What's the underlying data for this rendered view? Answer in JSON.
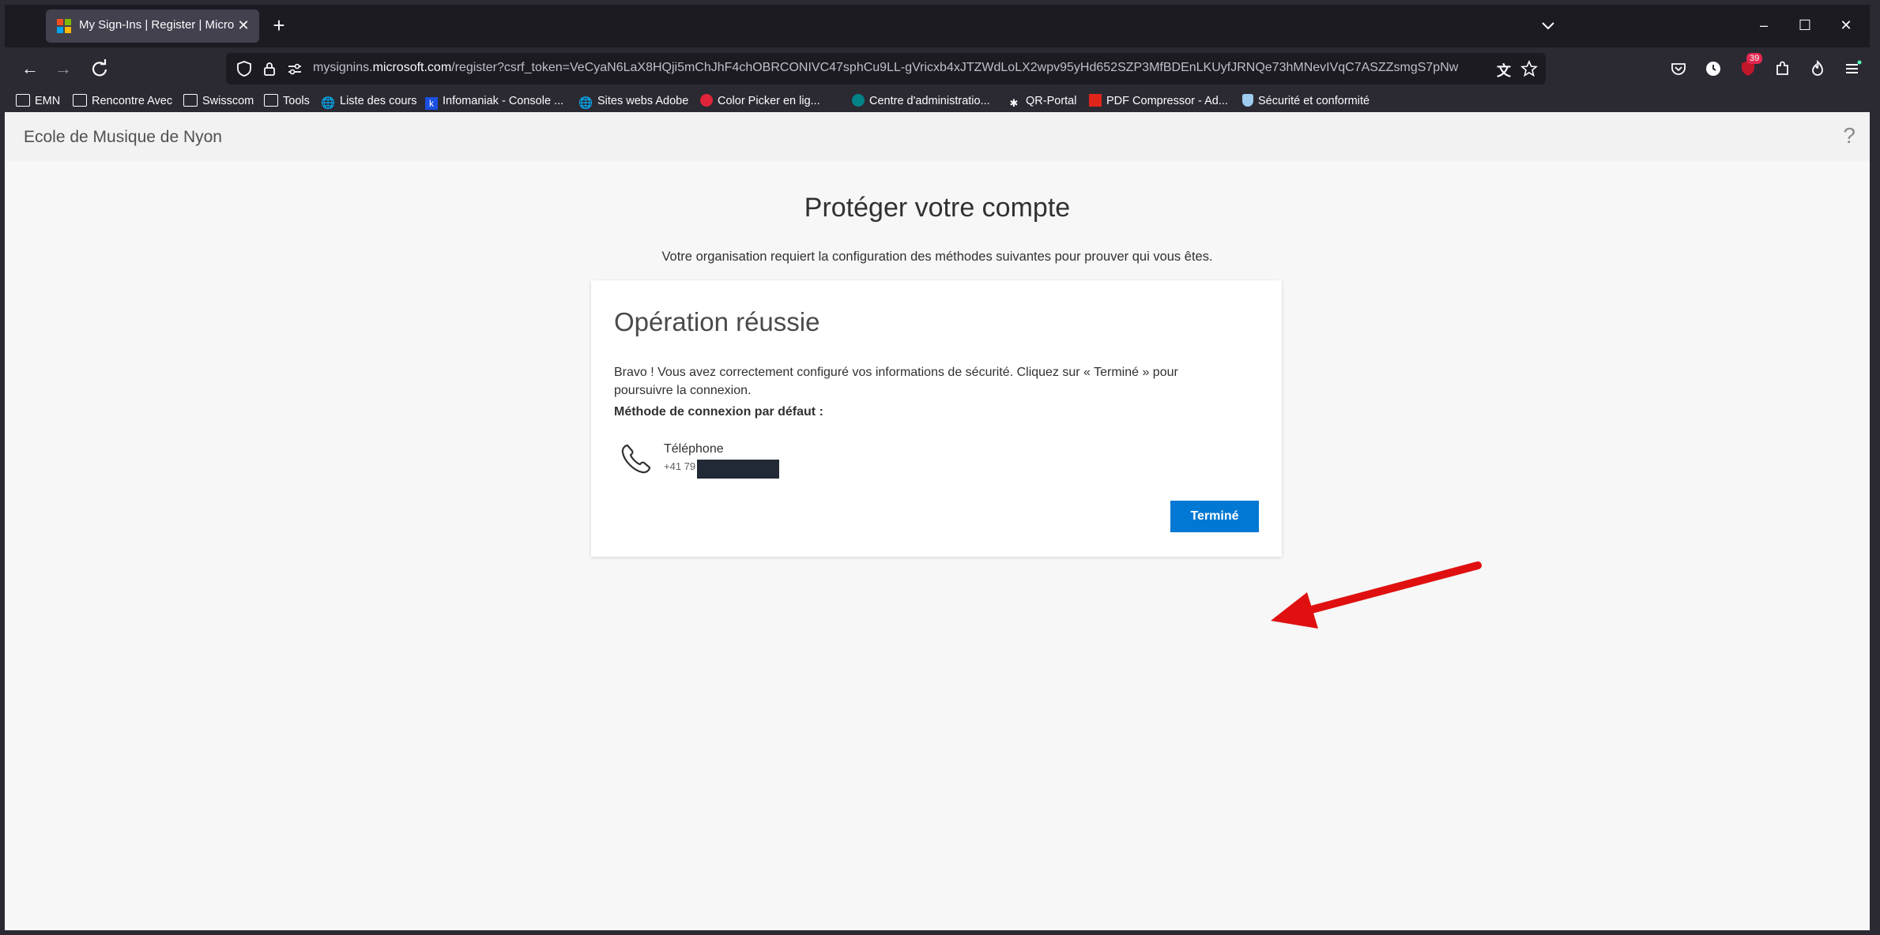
{
  "browser": {
    "tab_title": "My Sign-Ins | Register | Microsoft",
    "url_domain": "mysignins.microsoft.com",
    "url_prefix": "mysignins.",
    "url_domain_core": "microsoft.com",
    "url_path": "/register?csrf_token=VeCyaN6LaX8HQji5mChJhF4chOBRCONIVC47sphCu9LL-gVricxb4xJTZWdLoLX2wpv95yHd652SZP3MfBDEnLKUyfJRNQe73hMNevIVqC7ASZZsmgS7pNw",
    "badge_count": "39"
  },
  "bookmarks": [
    {
      "label": "EMN",
      "icon": "folder-icon"
    },
    {
      "label": "Rencontre Avec",
      "icon": "folder-icon"
    },
    {
      "label": "Swisscom",
      "icon": "folder-icon"
    },
    {
      "label": "Tools",
      "icon": "folder-icon"
    },
    {
      "label": "Liste des cours",
      "icon": "globe-icon"
    },
    {
      "label": "Infomaniak - Console ...",
      "icon": "infomaniak-icon"
    },
    {
      "label": "Sites webs Adobe",
      "icon": "globe-icon"
    },
    {
      "label": "Color Picker en lig...",
      "icon": "color-picker-icon"
    },
    {
      "label": "Centre d'administratio...",
      "icon": "sharepoint-icon"
    },
    {
      "label": "QR-Portal",
      "icon": "qr-icon"
    },
    {
      "label": "PDF Compressor - Ad...",
      "icon": "adobe-icon"
    },
    {
      "label": "Sécurité et conformité",
      "icon": "shield-icon"
    }
  ],
  "page": {
    "org_name": "Ecole de Musique de Nyon",
    "help": "?",
    "title": "Protéger votre compte",
    "subtitle": "Votre organisation requiert la configuration des méthodes suivantes pour prouver qui vous êtes.",
    "card": {
      "title": "Opération réussie",
      "message": "Bravo ! Vous avez correctement configuré vos informations de sécurité. Cliquez sur « Terminé » pour poursuivre la connexion.",
      "default_label": "Méthode de connexion par défaut :",
      "method_name": "Téléphone",
      "method_number": "+41 79",
      "done_button": "Terminé"
    }
  },
  "colors": {
    "accent": "#0078d4",
    "annotation_arrow": "#e01010"
  }
}
